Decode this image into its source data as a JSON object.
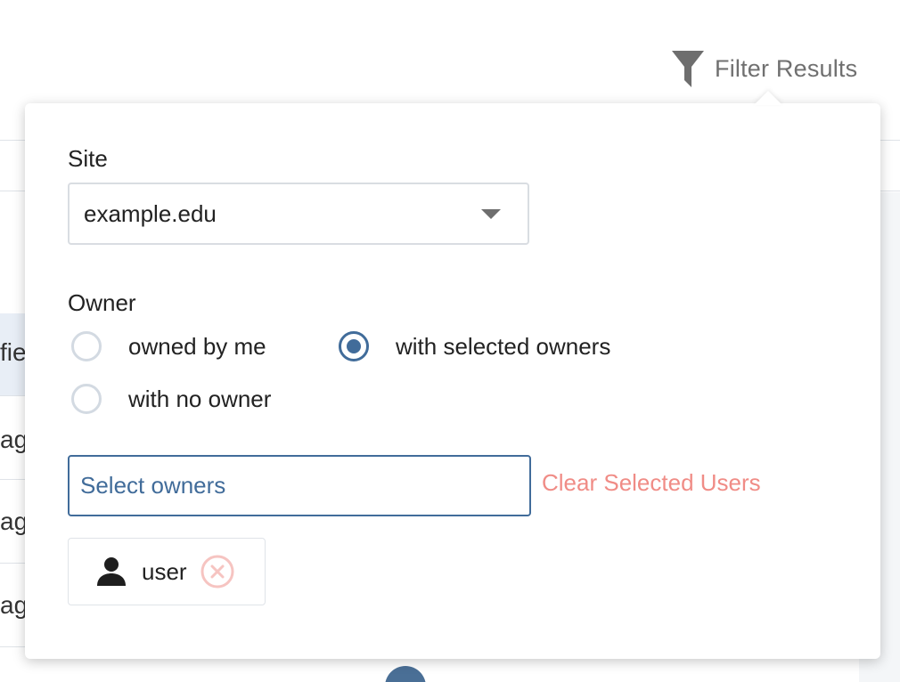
{
  "filter": {
    "label": "Filter Results",
    "icon": "funnel-icon"
  },
  "site": {
    "label": "Site",
    "selected": "example.edu"
  },
  "owner": {
    "label": "Owner",
    "options": [
      {
        "label": "owned by me",
        "checked": false
      },
      {
        "label": "with selected owners",
        "checked": true
      },
      {
        "label": "with no owner",
        "checked": false
      }
    ]
  },
  "owners_search": {
    "placeholder": "Select owners",
    "value": ""
  },
  "clear_label": "Clear Selected Users",
  "selected_users": [
    {
      "label": "user",
      "icon": "person-icon"
    }
  ],
  "background": {
    "row_texts": [
      "fie",
      "ago",
      "ago",
      "ago"
    ]
  },
  "colors": {
    "accent": "#416c9a",
    "danger": "#f08c86",
    "muted": "#707070"
  }
}
